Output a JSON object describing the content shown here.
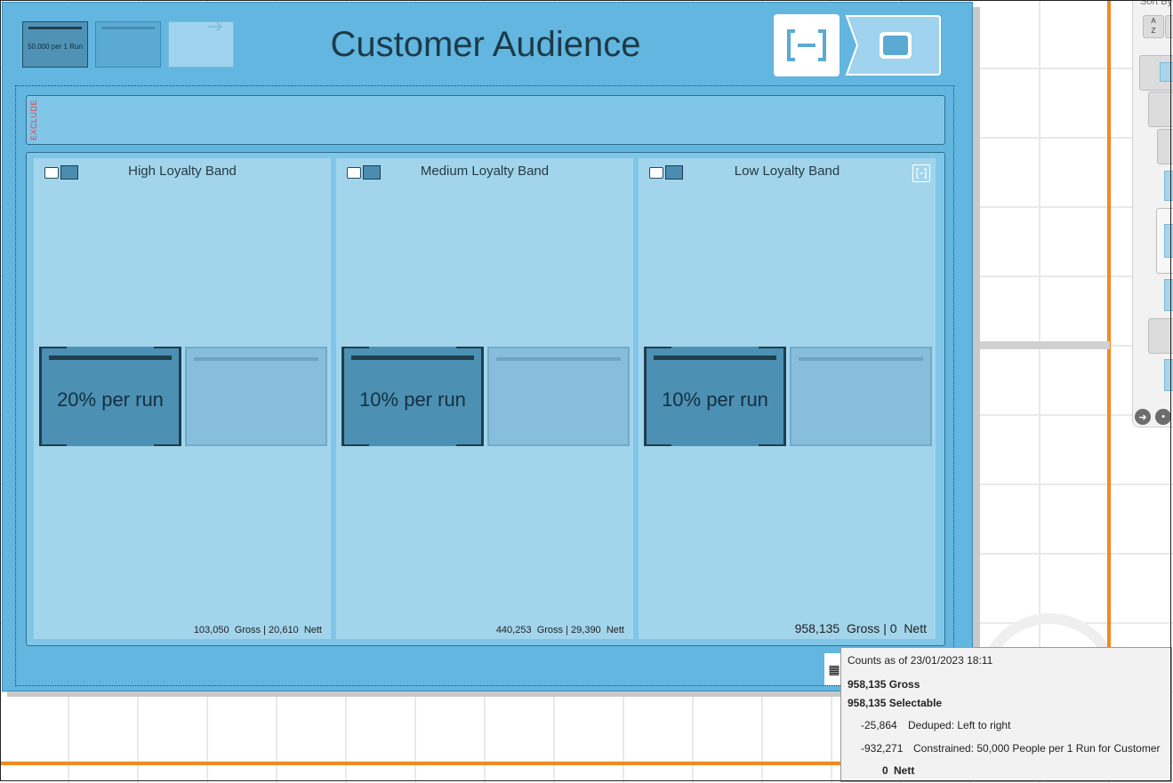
{
  "header": {
    "title": "Customer Audience",
    "thumb_label": "50,000 per 1 Run"
  },
  "side_panel": {
    "sort_label": "Sort By"
  },
  "exclude": {
    "label": "EXCLUDE"
  },
  "bands": [
    {
      "title": "High Loyalty Band",
      "run_label": "20% per run",
      "gross": "103,050",
      "gross_label": "Gross",
      "nett": "20,610",
      "nett_label": "Nett"
    },
    {
      "title": "Medium Loyalty Band",
      "run_label": "10% per run",
      "gross": "440,253",
      "gross_label": "Gross",
      "nett": "29,390",
      "nett_label": "Nett"
    },
    {
      "title": "Low Loyalty Band",
      "run_label": "10% per run",
      "gross": "958,135",
      "gross_label": "Gross",
      "nett": "0",
      "nett_label": "Nett"
    }
  ],
  "tooltip": {
    "counts_as_of": "Counts as of 23/01/2023 18:11",
    "gross": "958,135 Gross",
    "selectable": "958,135 Selectable",
    "deduped_value": "-25,864",
    "deduped_label": "Deduped: Left to right",
    "constrained_value": "-932,271",
    "constrained_label": "Constrained: 50,000 People per 1 Run for Customer",
    "nett_value": "0",
    "nett_label": "Nett"
  },
  "colors": {
    "canvas": "#62b6df",
    "band": "#a2d5ec",
    "run_dark": "#4c90b4",
    "accent_orange": "#f08a24"
  }
}
